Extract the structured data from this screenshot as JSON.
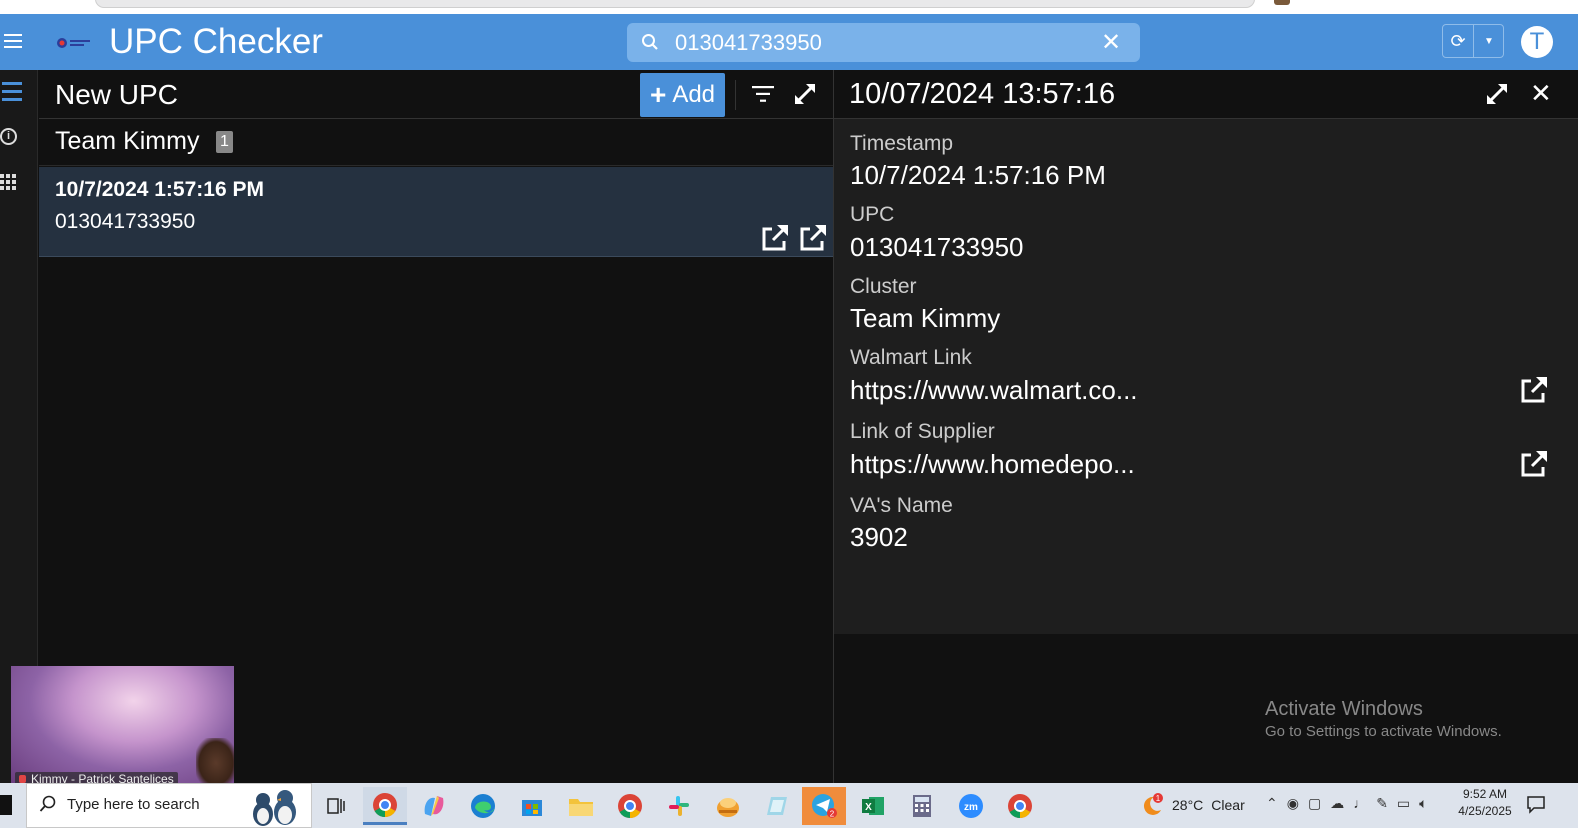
{
  "app": {
    "title": "UPC Checker",
    "avatar_letter": "T"
  },
  "search": {
    "value": "013041733950",
    "clear_label": "✕"
  },
  "list": {
    "title": "New UPC",
    "add_label": "Add",
    "group": {
      "name": "Team Kimmy",
      "count": "1"
    },
    "rows": [
      {
        "timestamp": "10/7/2024 1:57:16 PM",
        "upc": "013041733950"
      }
    ]
  },
  "detail": {
    "title": "10/07/2024 13:57:16",
    "close_label": "✕",
    "fields": [
      {
        "label": "Timestamp",
        "value": "10/7/2024 1:57:16 PM"
      },
      {
        "label": "UPC",
        "value": "013041733950"
      },
      {
        "label": "Cluster",
        "value": "Team Kimmy"
      },
      {
        "label": "Walmart Link",
        "value": "https://www.walmart.co..."
      },
      {
        "label": "Link of Supplier",
        "value": "https://www.homedepo..."
      },
      {
        "label": "VA's Name",
        "value": "3902"
      }
    ]
  },
  "watermark": {
    "line1": "Activate Windows",
    "line2": "Go to Settings to activate Windows."
  },
  "webcam": {
    "label": "Kimmy - Patrick Santelices"
  },
  "taskbar": {
    "search_placeholder": "Type here to search",
    "weather_temp": "28°C",
    "weather_text": "Clear",
    "weather_badge": "1",
    "time": "9:52 AM",
    "date": "4/25/2025",
    "telegram_badge": "2",
    "apps": [
      "task-view",
      "chrome",
      "copilot",
      "edge",
      "store",
      "file-explorer",
      "chrome",
      "slack",
      "app-orange",
      "app-notes",
      "telegram",
      "excel",
      "calculator",
      "zoom",
      "chrome"
    ]
  },
  "colors": {
    "header": "#4a90d9",
    "accent": "#4a90d9",
    "row_selected": "#253140",
    "detail_bg": "#1e1e1e",
    "panel_bg": "#111111"
  }
}
